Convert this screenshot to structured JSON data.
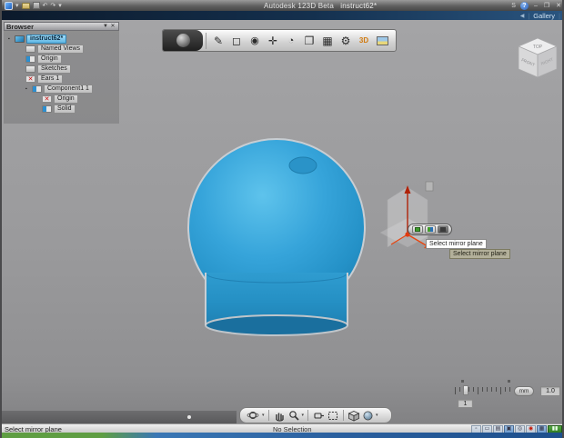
{
  "titlebar": {
    "title": "Autodesk 123D Beta",
    "document": "instruct62*",
    "window_controls": {
      "minimize": "–",
      "restore": "❐",
      "close": "✕"
    },
    "signin_label": "S",
    "help_label": "?"
  },
  "gallery_bar": {
    "back": "◀",
    "sep": "|",
    "label": "Gallery"
  },
  "browser": {
    "header": "Browser",
    "header_icons": [
      "filter-icon",
      "close-icon"
    ],
    "filter_glyph": "▼",
    "close_glyph": "✕",
    "items": [
      {
        "label": "instruct62*",
        "level": 0,
        "selected": true
      },
      {
        "label": "Named Views",
        "level": 1
      },
      {
        "label": "Origin",
        "level": 1
      },
      {
        "label": "Sketches",
        "level": 1
      },
      {
        "label": "Ears 1",
        "level": 1
      },
      {
        "label": "Component1 1",
        "level": 1
      },
      {
        "label": "Origin",
        "level": 2
      },
      {
        "label": "Solid",
        "level": 2
      }
    ]
  },
  "ribbon": {
    "icons": [
      "menu-sphere",
      "sketch",
      "primitive-box",
      "revolve",
      "move",
      "rotate",
      "combine",
      "pattern",
      "gears",
      "text-3d",
      "material-image"
    ],
    "glyphs": {
      "sketch": "✎",
      "box": "◻",
      "revolve": "◉",
      "move": "✛",
      "rotate": "◔",
      "combine": "❐",
      "pattern": "▦",
      "gears": "⚙",
      "text3d": "3D"
    }
  },
  "viewcube": {
    "top": "TOP",
    "front": "FRONT",
    "right": "RIGHT"
  },
  "mirror_widget": {
    "buttons": [
      "accept",
      "flip",
      "cancel"
    ],
    "tooltip": "Select mirror plane",
    "prompt": "Select mirror plane"
  },
  "ruler": {
    "slider_value": "1",
    "unit": "mm",
    "scale": "1.0"
  },
  "nav_toolbar": {
    "icons": [
      "orbit",
      "pan",
      "zoom",
      "constrained-orbit",
      "fit",
      "view-cube",
      "shading"
    ],
    "caret": "▾"
  },
  "status_bar": {
    "message": "Select mirror plane",
    "selection": "No Selection",
    "toggles": [
      "select-toggle",
      "window-toggle",
      "grid-toggle",
      "snap-toggle",
      "ortho-toggle",
      "record-toggle",
      "keyboard-toggle",
      "performance-meter"
    ],
    "glyphs": {
      "t1": "▫",
      "t2": "▭",
      "t3": "▤",
      "t4": "▣",
      "t5": "◎",
      "t6": "◉",
      "t7": "▦",
      "t8": "▮▮"
    }
  },
  "glyphs": {
    "caret": "▾",
    "undo": "↶",
    "redo": "↷",
    "bullet": "▪",
    "redx": "✕",
    "dot": "●"
  }
}
